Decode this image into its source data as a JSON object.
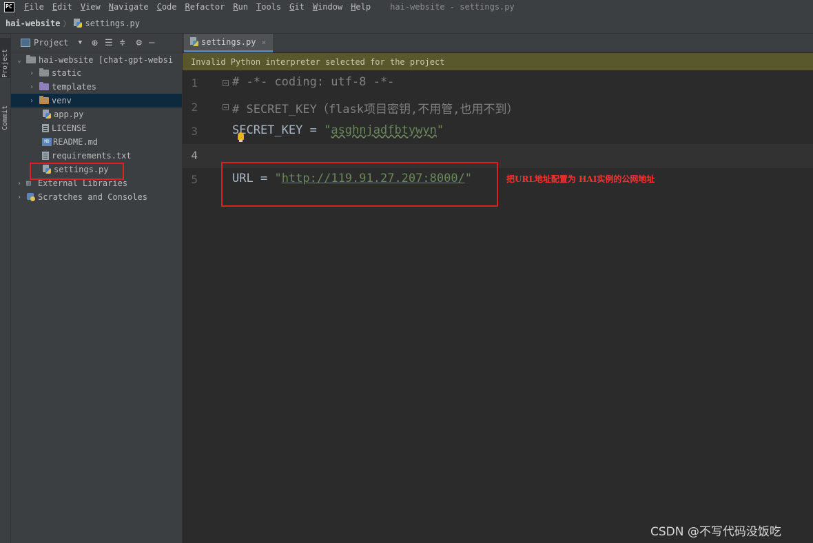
{
  "app": {
    "logo_text": "PC",
    "window_title": "hai-website - settings.py"
  },
  "menu": [
    {
      "accel": "F",
      "rest": "ile"
    },
    {
      "accel": "E",
      "rest": "dit"
    },
    {
      "accel": "V",
      "rest": "iew"
    },
    {
      "accel": "N",
      "rest": "avigate"
    },
    {
      "accel": "C",
      "rest": "ode"
    },
    {
      "accel": "R",
      "rest": "efactor"
    },
    {
      "accel": "R",
      "rest": "un",
      "label": "Run"
    },
    {
      "accel": "T",
      "rest": "ools"
    },
    {
      "accel": "G",
      "rest": "it"
    },
    {
      "accel": "W",
      "rest": "indow"
    },
    {
      "accel": "H",
      "rest": "elp"
    }
  ],
  "breadcrumb": {
    "project": "hai-website",
    "file": "settings.py"
  },
  "toolstrip": {
    "project_tab": "Project",
    "commit_tab": "Commit"
  },
  "project_panel": {
    "title": "Project",
    "tree": [
      {
        "label": "hai-website [chat-gpt-websi",
        "type": "root"
      },
      {
        "label": "static",
        "type": "folder"
      },
      {
        "label": "templates",
        "type": "folder-purple"
      },
      {
        "label": "venv",
        "type": "folder-orange"
      },
      {
        "label": "app.py",
        "type": "py"
      },
      {
        "label": "LICENSE",
        "type": "txt"
      },
      {
        "label": "README.md",
        "type": "md"
      },
      {
        "label": "requirements.txt",
        "type": "txt"
      },
      {
        "label": "settings.py",
        "type": "py"
      },
      {
        "label": "External Libraries",
        "type": "lib"
      },
      {
        "label": "Scratches and Consoles",
        "type": "scratch"
      }
    ]
  },
  "editor": {
    "tab_label": "settings.py",
    "banner": "Invalid Python interpreter selected for the project",
    "lines": [
      {
        "no": "1",
        "comment": "# -*- coding: utf-8 -*-"
      },
      {
        "no": "2",
        "comment": "# SECRET_KEY（flask项目密钥,不用管,也用不到）"
      },
      {
        "no": "3",
        "name": "SECRET_KEY",
        "op": " = ",
        "q1": "\"",
        "value": "asghnjadfbtywyn",
        "q2": "\""
      },
      {
        "no": "4"
      },
      {
        "no": "5",
        "name": "URL",
        "op": " = ",
        "q1": "\"",
        "value": "http://119.91.27.207:8000/",
        "q2": "\""
      }
    ]
  },
  "annotation": {
    "text": "把URL地址配置为 HAI实例的公网地址",
    "color": "#e02020"
  },
  "watermark": "CSDN @不写代码没饭吃"
}
